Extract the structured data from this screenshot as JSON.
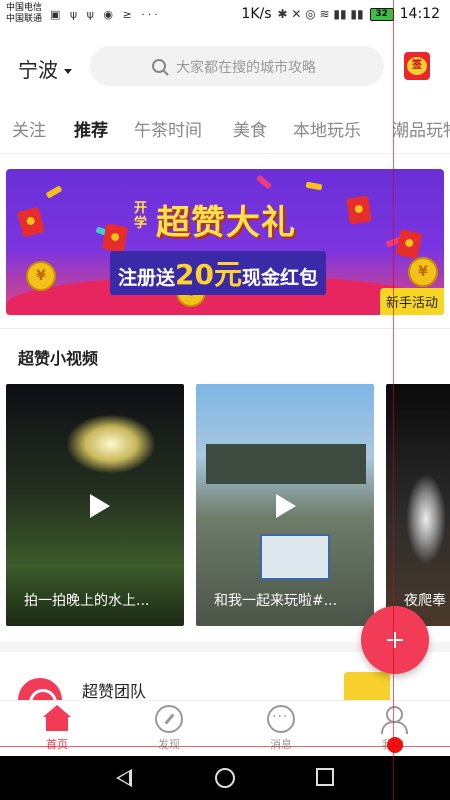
{
  "status_bar": {
    "carrier_1": "中国电信",
    "carrier_2": "中国联通",
    "speed": "1K/s",
    "battery": "32",
    "time": "14:12"
  },
  "header": {
    "city": "宁波",
    "search_placeholder": "大家都在搜的城市攻略",
    "sign_icon_label": "签"
  },
  "tabs": [
    {
      "label": "关注",
      "active": false
    },
    {
      "label": "推荐",
      "active": true
    },
    {
      "label": "午茶时间",
      "active": false
    },
    {
      "label": "美食",
      "active": false
    },
    {
      "label": "本地玩乐",
      "active": false
    },
    {
      "label": "潮品玩物",
      "active": false
    }
  ],
  "banner": {
    "kaixue": "开学",
    "title": "超赞大礼",
    "sub_prefix": "注册送",
    "sub_amount": "20元",
    "sub_suffix": "现金红包",
    "tag": "新手活动",
    "coin_symbol": "¥"
  },
  "section": {
    "title": "超赞小视频"
  },
  "videos": [
    {
      "caption": "拍一拍晚上的水上..."
    },
    {
      "caption": "和我一起来玩啦#..."
    },
    {
      "caption": "夜爬奉"
    }
  ],
  "team": {
    "name": "超赞团队"
  },
  "bottom_nav": [
    {
      "label": "首页",
      "active": true
    },
    {
      "label": "发现",
      "active": false
    },
    {
      "label": "消息",
      "active": false
    },
    {
      "label": "我的",
      "active": false
    }
  ],
  "colors": {
    "accent": "#f23b56",
    "banner_purple": "#6a2fd7",
    "banner_yellow": "#ffe14a"
  }
}
